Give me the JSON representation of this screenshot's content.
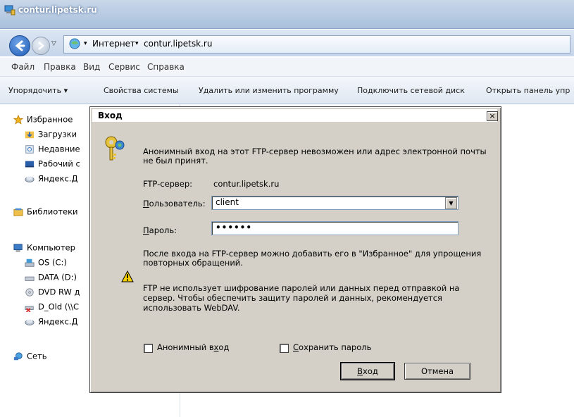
{
  "window": {
    "title": "contur.lipetsk.ru"
  },
  "address": {
    "crumb1": "Интернет",
    "crumb2": "contur.lipetsk.ru"
  },
  "menu": [
    "Файл",
    "Правка",
    "Вид",
    "Сервис",
    "Справка"
  ],
  "toolbar": {
    "organize": "Упорядочить",
    "system_props": "Свойства системы",
    "uninstall": "Удалить или изменить программу",
    "map_drive": "Подключить сетевой диск",
    "control_panel": "Открыть панель упр"
  },
  "sidebar": {
    "favorites": "Избранное",
    "downloads": "Загрузки",
    "recent": "Недавние",
    "desktop": "Рабочий с",
    "yandex1": "Яндекс.Д",
    "libraries": "Библиотеки",
    "computer": "Компьютер",
    "os": "OS (C:)",
    "data": "DATA (D:)",
    "dvd": "DVD RW д",
    "dold": "D_Old (\\\\C",
    "yandex2": "Яндекс.Д",
    "network": "Сеть"
  },
  "dialog": {
    "title": "Вход",
    "close": "×",
    "message_line1": "Анонимный вход на этот FTP-сервер невозможен или адрес электронной почты",
    "message_line2": "не был принят.",
    "server_label": "FTP-сервер:",
    "server_value": "contur.lipetsk.ru",
    "user_label": "Пользователь:",
    "user_value": "client",
    "password_label": "Пароль:",
    "password_value": "••••••",
    "info_line1": "После входа на FTP-сервер можно добавить его в \"Избранное\" для упрощения",
    "info_line2": "повторных обращений.",
    "warn_line1": "FTP не использует шифрование паролей или данных перед отправкой на",
    "warn_line2": "сервер. Чтобы обеспечить защиту паролей и данных, рекомендуется",
    "warn_line3": "использовать WebDAV.",
    "anon_label": "Анонимный вход",
    "save_label": "Сохранить пароль",
    "login_button": "Вход",
    "cancel_button": "Отмена"
  }
}
